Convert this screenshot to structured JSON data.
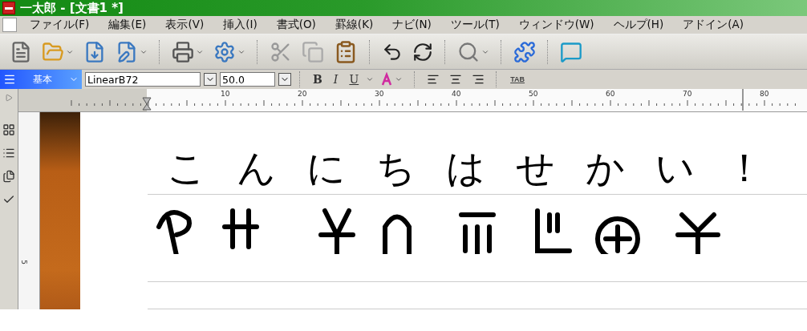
{
  "window": {
    "title": "一太郎 - [文書1 *]"
  },
  "menu": [
    "ファイル(F)",
    "編集(E)",
    "表示(V)",
    "挿入(I)",
    "書式(O)",
    "罫線(K)",
    "ナビ(N)",
    "ツール(T)",
    "ウィンドウ(W)",
    "ヘルプ(H)",
    "アドイン(A)"
  ],
  "format_bar": {
    "style": "基本",
    "font": "LinearB72",
    "size": "50.0",
    "bold": "B",
    "italic": "I",
    "underline": "U",
    "tab": "TAB"
  },
  "ruler": {
    "labels": [
      "10",
      "20",
      "30",
      "40",
      "50",
      "60",
      "70",
      "80"
    ],
    "vertical_labels": [
      "5"
    ]
  },
  "document": {
    "lines": [
      "こんにちはせかい！"
    ]
  }
}
